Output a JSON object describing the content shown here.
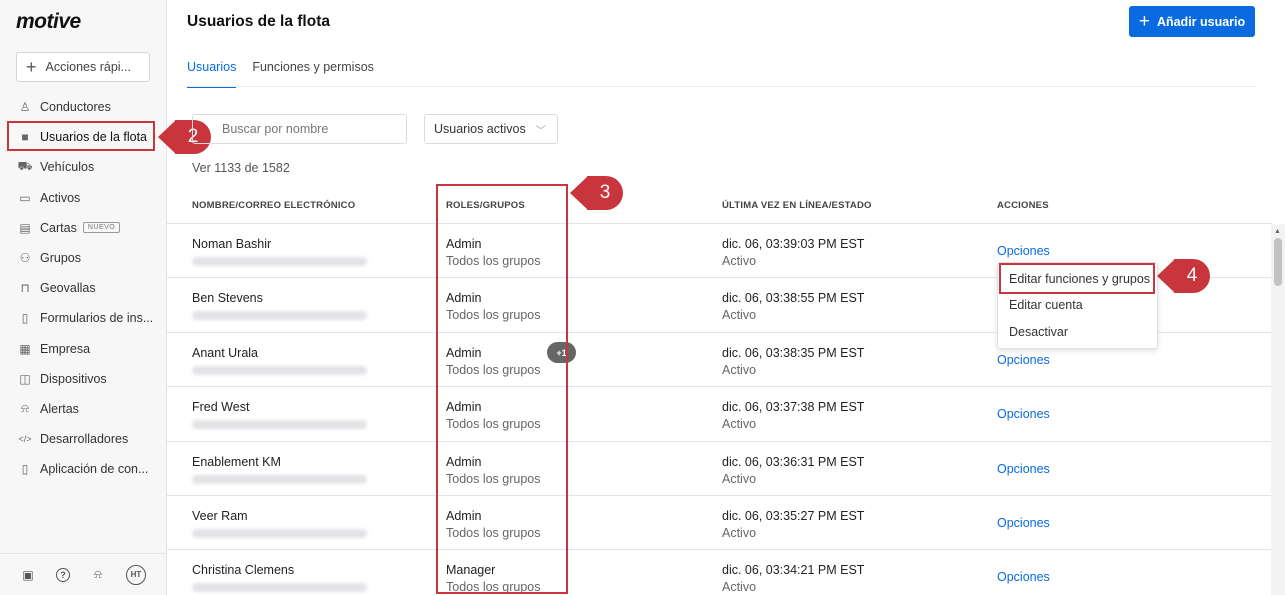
{
  "brand": "motive",
  "sidebar": {
    "quick_actions": "Acciones rápi...",
    "items": [
      {
        "label": "Conductores",
        "icon": "person-icon",
        "glyph": "♙"
      },
      {
        "label": "Usuarios de la flota",
        "icon": "monitor-icon",
        "glyph": "■"
      },
      {
        "label": "Vehículos",
        "icon": "truck-icon",
        "glyph": "⛟"
      },
      {
        "label": "Activos",
        "icon": "trailer-icon",
        "glyph": "▭"
      },
      {
        "label": "Cartas",
        "icon": "card-icon",
        "glyph": "▤",
        "badge": "NUEVO"
      },
      {
        "label": "Grupos",
        "icon": "group-icon",
        "glyph": "⚇"
      },
      {
        "label": "Geovallas",
        "icon": "geofence-icon",
        "glyph": "⊓"
      },
      {
        "label": "Formularios de ins...",
        "icon": "document-icon",
        "glyph": "▯"
      },
      {
        "label": "Empresa",
        "icon": "building-icon",
        "glyph": "▦"
      },
      {
        "label": "Dispositivos",
        "icon": "device-icon",
        "glyph": "◫"
      },
      {
        "label": "Alertas",
        "icon": "bell-icon",
        "glyph": "⍾"
      },
      {
        "label": "Desarrolladores",
        "icon": "code-icon",
        "glyph": "</>"
      },
      {
        "label": "Aplicación de con...",
        "icon": "phone-icon",
        "glyph": "▯"
      }
    ],
    "footer": {
      "avatar": "HT"
    }
  },
  "header": {
    "title": "Usuarios de la flota",
    "add_button": "Añadir usuario"
  },
  "tabs": [
    {
      "label": "Usuarios",
      "active": true
    },
    {
      "label": "Funciones y permisos",
      "active": false
    }
  ],
  "filters": {
    "search_placeholder": "Buscar por nombre",
    "status_select": "Usuarios activos"
  },
  "count_text": "Ver 1133 de 1582",
  "table": {
    "columns": [
      "NOMBRE/CORREO ELECTRÓNICO",
      "ROLES/GRUPOS",
      "ÚLTIMA VEZ EN LÍNEA/ESTADO",
      "ACCIONES"
    ],
    "rows": [
      {
        "name": "Noman Bashir",
        "role": "Admin",
        "groups": "Todos los grupos",
        "last_seen": "dic. 06, 03:39:03 PM EST",
        "status": "Activo",
        "action": "Opciones"
      },
      {
        "name": "Ben Stevens",
        "role": "Admin",
        "groups": "Todos los grupos",
        "last_seen": "dic. 06, 03:38:55 PM EST",
        "status": "Activo",
        "action": ""
      },
      {
        "name": "Anant Urala",
        "role": "Admin",
        "groups": "Todos los grupos",
        "last_seen": "dic. 06, 03:38:35 PM EST",
        "status": "Activo",
        "action": "Opciones"
      },
      {
        "name": "Fred West",
        "role": "Admin",
        "groups": "Todos los grupos",
        "last_seen": "dic. 06, 03:37:38 PM EST",
        "status": "Activo",
        "action": "Opciones"
      },
      {
        "name": "Enablement KM",
        "role": "Admin",
        "groups": "Todos los grupos",
        "last_seen": "dic. 06, 03:36:31 PM EST",
        "status": "Activo",
        "action": "Opciones"
      },
      {
        "name": "Veer Ram",
        "role": "Admin",
        "groups": "Todos los grupos",
        "last_seen": "dic. 06, 03:35:27 PM EST",
        "status": "Activo",
        "action": "Opciones"
      },
      {
        "name": "Christina Clemens",
        "role": "Manager",
        "groups": "Todos los grupos",
        "last_seen": "dic. 06, 03:34:21 PM EST",
        "status": "Activo",
        "action": "Opciones"
      }
    ],
    "extra_groups_badge": "+1"
  },
  "options_menu": {
    "items": [
      "Editar funciones y grupos",
      "Editar cuenta",
      "Desactivar"
    ]
  },
  "callouts": [
    "2",
    "3",
    "4"
  ],
  "colors": {
    "accent": "#0a6be0",
    "callout": "#c9353c"
  }
}
